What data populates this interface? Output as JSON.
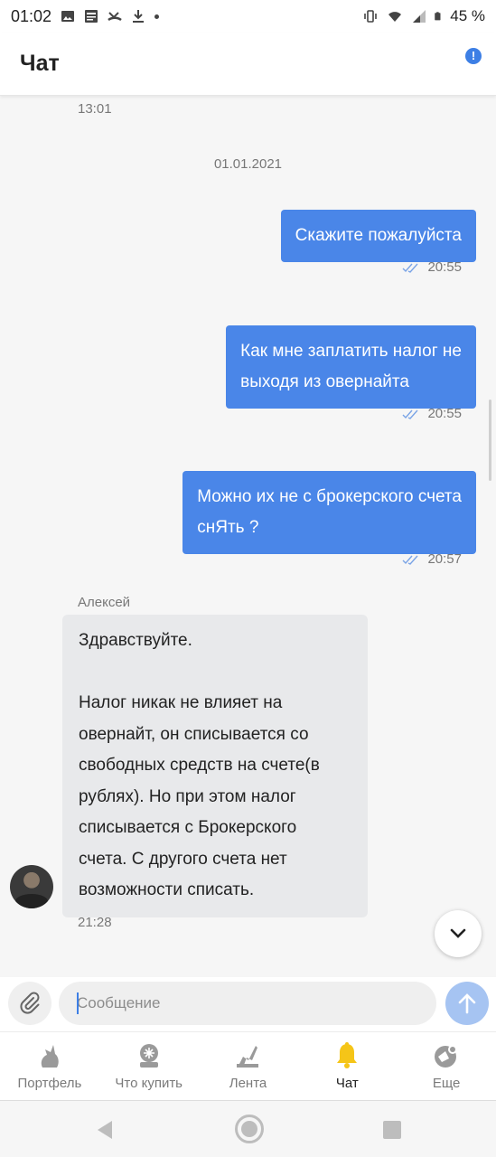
{
  "status": {
    "time": "01:02",
    "battery": "45 %"
  },
  "header": {
    "title": "Чат"
  },
  "chat": {
    "prev_time": "13:01",
    "date_separator": "01.01.2021",
    "outgoing": [
      {
        "text_lines": [
          "Скажите пожалуйста"
        ],
        "time": "20:55"
      },
      {
        "text_lines": [
          "Как мне заплатить налог не",
          "выходя из овернайта"
        ],
        "time": "20:55"
      },
      {
        "text_lines": [
          "Можно их не с брокерского счета",
          "снЯть ?"
        ],
        "time": "20:57"
      }
    ],
    "incoming": {
      "sender": "Алексей",
      "text_lines": [
        "Здравствуйте.",
        "",
        "Налог никак не влияет на",
        "овернайт, он списывается со",
        "свободных средств на счете(в",
        "рублях). Но при этом налог",
        "списывается с Брокерского",
        "счета. С другого счета нет",
        "возможности списать."
      ],
      "time": "21:28"
    }
  },
  "composer": {
    "placeholder": "Сообщение"
  },
  "tabs": [
    {
      "label": "Портфель",
      "icon": "portfolio-icon"
    },
    {
      "label": "Что купить",
      "icon": "what-to-buy-icon"
    },
    {
      "label": "Лента",
      "icon": "feed-icon"
    },
    {
      "label": "Чат",
      "icon": "chat-bell-icon",
      "active": true
    },
    {
      "label": "Еще",
      "icon": "more-icon"
    }
  ],
  "colors": {
    "accent": "#4a86e8",
    "active_tab_icon": "#f5c518"
  }
}
